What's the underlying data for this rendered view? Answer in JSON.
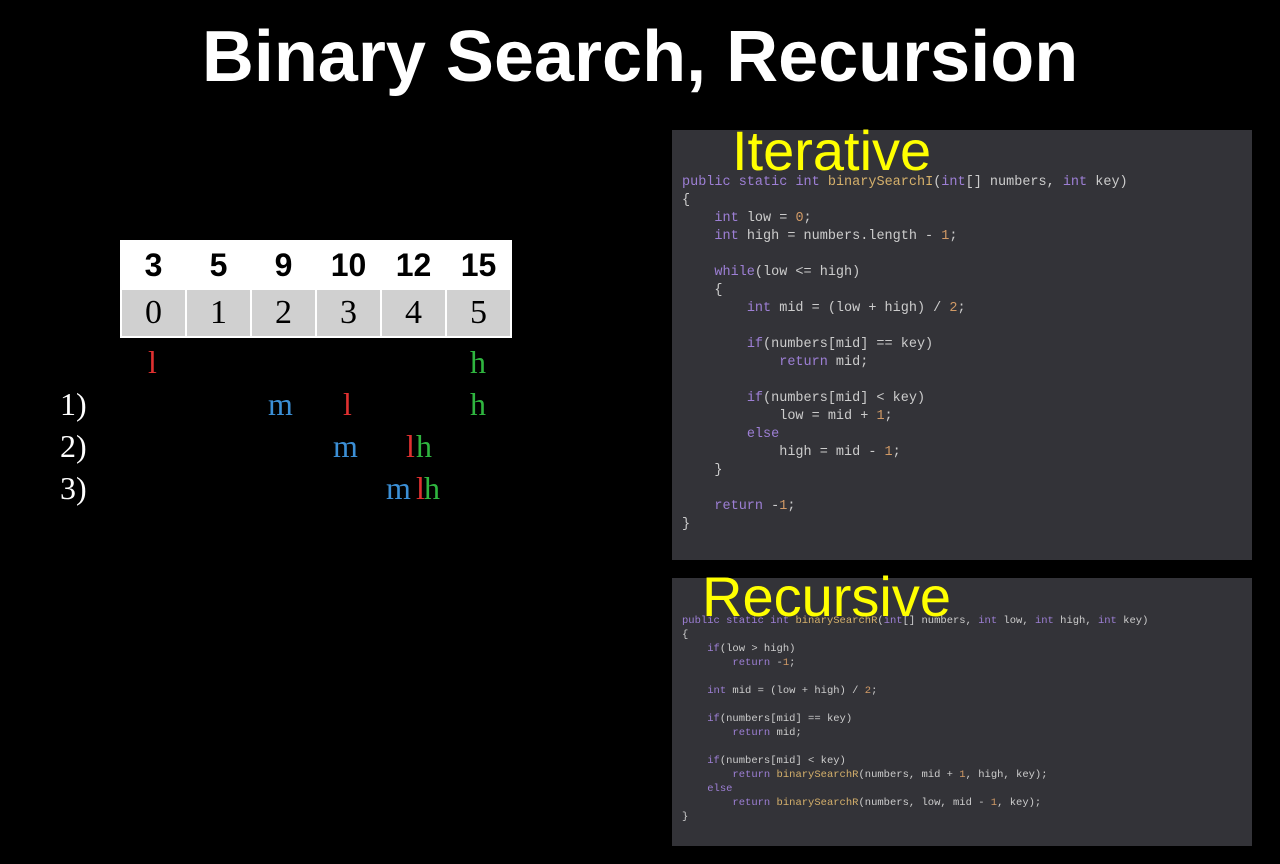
{
  "title": "Binary Search, Recursion",
  "array": {
    "values": [
      "3",
      "5",
      "9",
      "10",
      "12",
      "15"
    ],
    "indices": [
      "0",
      "1",
      "2",
      "3",
      "4",
      "5"
    ]
  },
  "trace": {
    "initial": {
      "l_col": 0,
      "h_col": 5
    },
    "steps": [
      {
        "label": "1)",
        "m_col": 2,
        "l_col": 3,
        "h_col": 5
      },
      {
        "label": "2)",
        "m_col": 3,
        "l_col": 4,
        "h_col": 4,
        "lh_overlap": true
      },
      {
        "label": "3)",
        "m_col": 4,
        "l_col": 4,
        "h_col": 4,
        "mlh_overlap": true
      }
    ]
  },
  "overlays": {
    "iterative": "Iterative",
    "recursive": "Recursive"
  },
  "code": {
    "iterative_sig_pre": "public static int ",
    "iterative_fn": "binarySearchI",
    "iterative_sig_post": "(int[] numbers, int key)",
    "it_l1": "    int low = 0;",
    "it_l2": "    int high = numbers.length - 1;",
    "it_l3": "    while(low <= high)",
    "it_l4": "        int mid = (low + high) / 2;",
    "it_l5": "        if(numbers[mid] == key)",
    "it_l6": "            return mid;",
    "it_l7": "        if(numbers[mid] < key)",
    "it_l8": "            low = mid + 1;",
    "it_l9": "        else",
    "it_l10": "            high = mid - 1;",
    "it_l11": "    return -1;",
    "recursive_sig_pre": "public static int ",
    "recursive_fn": "binarySearchR",
    "recursive_sig_post": "(int[] numbers, int low, int high, int key)",
    "rc_l1": "    if(low > high)",
    "rc_l2": "        return -1;",
    "rc_l3": "    int mid = (low + high) / 2;",
    "rc_l4": "    if(numbers[mid] == key)",
    "rc_l5": "        return mid;",
    "rc_l6": "    if(numbers[mid] < key)",
    "rc_l7a": "        return ",
    "rc_l7b": "binarySearchR",
    "rc_l7c": "(numbers, mid + 1, high, key);",
    "rc_l8": "    else",
    "rc_l9a": "        return ",
    "rc_l9b": "binarySearchR",
    "rc_l9c": "(numbers, low, mid - 1, key);"
  }
}
